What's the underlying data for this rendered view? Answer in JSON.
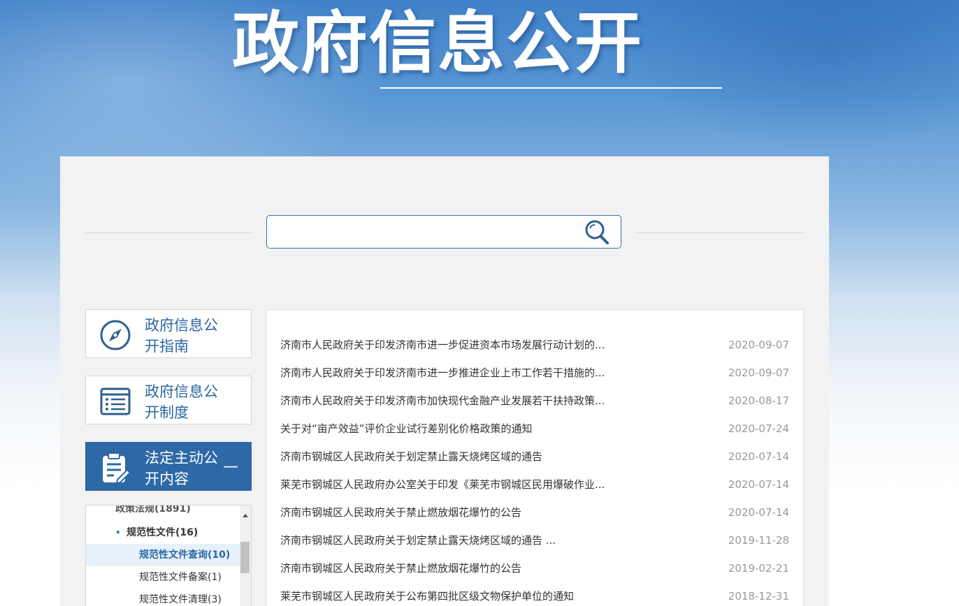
{
  "banner": {
    "title": "政府信息公开"
  },
  "search": {
    "placeholder": "",
    "value": "",
    "icon": "search-icon"
  },
  "nav_cards": [
    {
      "label": "政府信息公开指南",
      "icon": "compass-icon",
      "active": false
    },
    {
      "label": "政府信息公开制度",
      "icon": "list-icon",
      "active": false
    },
    {
      "label": "法定主动公开内容",
      "icon": "clipboard-edit-icon",
      "active": true,
      "toggle": "—"
    }
  ],
  "tree": {
    "clipped_item": "政策法规(1891)",
    "category": {
      "label": "规范性文件(16)",
      "bullet": "•"
    },
    "children": [
      {
        "label": "规范性文件查询(10)",
        "selected": true
      },
      {
        "label": "规范性文件备案(1)",
        "selected": false
      },
      {
        "label": "规范性文件清理(3)",
        "selected": false
      }
    ]
  },
  "list": {
    "items": [
      {
        "title": "济南市人民政府关于印发济南市进一步促进资本市场发展行动计划的...",
        "date": "2020-09-07"
      },
      {
        "title": "济南市人民政府关于印发济南市进一步推进企业上市工作若干措施的...",
        "date": "2020-09-07"
      },
      {
        "title": "济南市人民政府关于印发济南市加快现代金融产业发展若干扶持政策...",
        "date": "2020-08-17"
      },
      {
        "title": "关于对“亩产效益”评价企业试行差别化价格政策的通知",
        "date": "2020-07-24"
      },
      {
        "title": "济南市钢城区人民政府关于划定禁止露天烧烤区域的通告",
        "date": "2020-07-14"
      },
      {
        "title": "莱芜市钢城区人民政府办公室关于印发《莱芜市钢城区民用爆破作业...",
        "date": "2020-07-14"
      },
      {
        "title": "济南市钢城区人民政府关于禁止燃放烟花爆竹的公告",
        "date": "2020-07-14"
      },
      {
        "title": "济南市钢城区人民政府关于划定禁止露天烧烤区域的通告 ...",
        "date": "2019-11-28"
      },
      {
        "title": "济南市钢城区人民政府关于禁止燃放烟花爆竹的公告",
        "date": "2019-02-21"
      },
      {
        "title": "莱芜市钢城区人民政府关于公布第四批区级文物保护单位的通知",
        "date": "2018-12-31"
      }
    ]
  },
  "colors": {
    "brand_blue": "#2e68a6",
    "link_blue": "#2c67a5",
    "date_gray": "#999999"
  }
}
